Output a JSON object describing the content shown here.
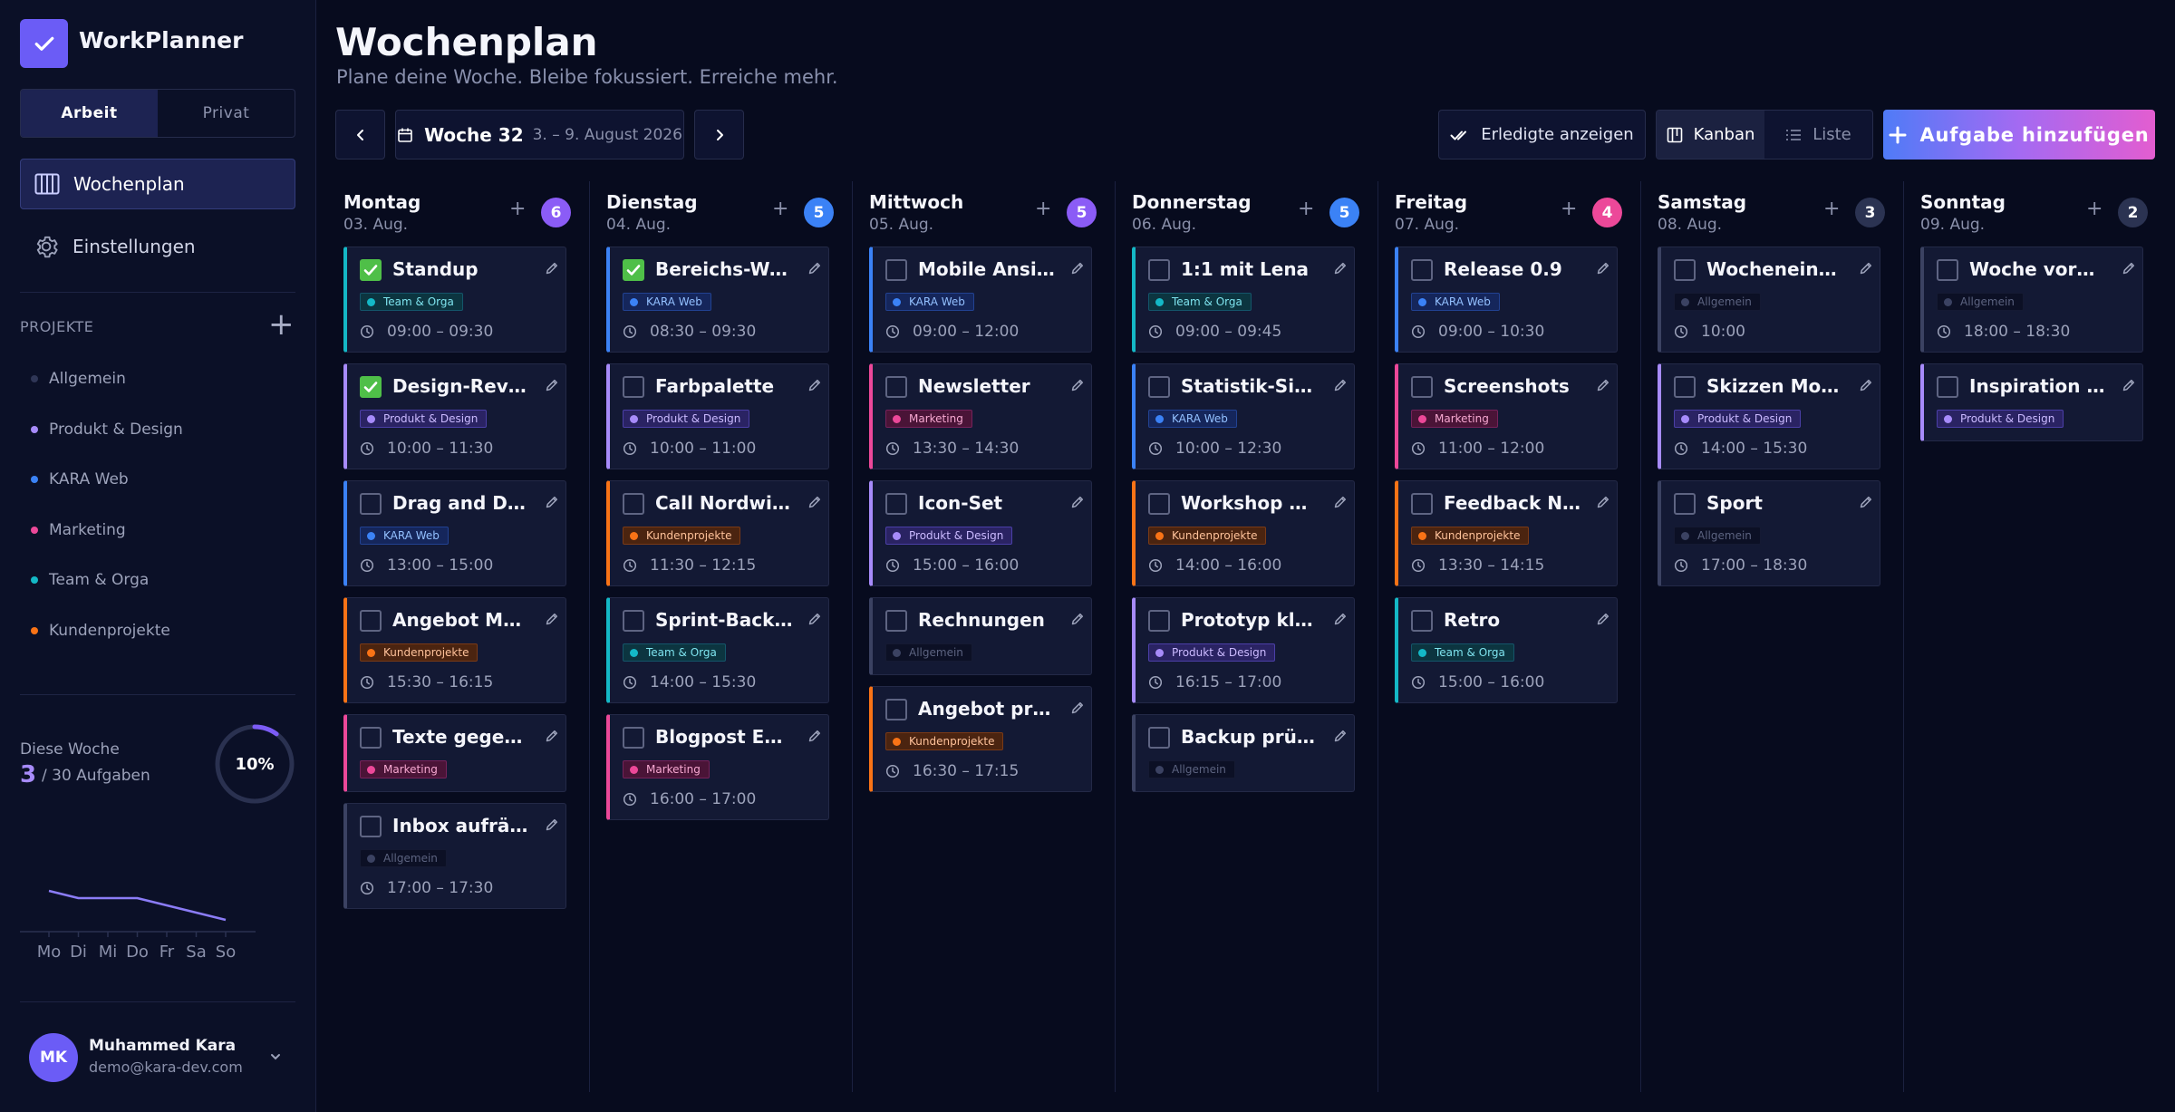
{
  "app": {
    "name": "WorkPlanner"
  },
  "mode_tabs": [
    "Arbeit",
    "Privat"
  ],
  "nav": [
    {
      "label": "Wochenplan",
      "icon": "board-icon"
    },
    {
      "label": "Einstellungen",
      "icon": "gear-icon"
    }
  ],
  "projects": {
    "heading": "PROJEKTE",
    "items": [
      {
        "label": "Allgemein",
        "color": "#2f3656"
      },
      {
        "label": "Produkt & Design",
        "color": "#a78bfa"
      },
      {
        "label": "KARA Web",
        "color": "#3b82f6"
      },
      {
        "label": "Marketing",
        "color": "#ec4899"
      },
      {
        "label": "Team & Orga",
        "color": "#14b8c6"
      },
      {
        "label": "Kundenprojekte",
        "color": "#f97316"
      }
    ]
  },
  "stats": {
    "label": "Diese Woche",
    "done": "3",
    "total": "/ 30 Aufgaben",
    "percent_label": "10%",
    "percent": 0.1,
    "days": [
      "Mo",
      "Di",
      "Mi",
      "Do",
      "Fr",
      "Sa",
      "So"
    ],
    "trend": [
      6,
      5,
      5,
      5,
      4,
      3,
      2
    ]
  },
  "user": {
    "initials": "MK",
    "name": "Muhammed Kara",
    "email": "demo@kara-dev.com"
  },
  "header": {
    "title": "Wochenplan",
    "subtitle": "Plane deine Woche. Bleibe fokussiert. Erreiche mehr.",
    "week_label": "Woche 32",
    "week_range": "3. – 9. August 2026",
    "show_done": "Erledigte anzeigen",
    "view_kanban": "Kanban",
    "view_list": "Liste",
    "add_task": "Aufgabe hinzufügen"
  },
  "tag_styles": {
    "Allgemein": {
      "color": "#3b4262",
      "bg": "#0c1025",
      "border": "#151a33",
      "text": "#5c6380"
    },
    "Produkt & Design": {
      "color": "#a78bfa",
      "bg": "#2a2363",
      "border": "#4b3fa7",
      "text": "#cbbaff"
    },
    "KARA Web": {
      "color": "#3b82f6",
      "bg": "#15265b",
      "border": "#224292",
      "text": "#93c0ff"
    },
    "Marketing": {
      "color": "#ec4899",
      "bg": "#4a1437",
      "border": "#76225a",
      "text": "#f7a8d1"
    },
    "Team & Orga": {
      "color": "#14b8c6",
      "bg": "#0c3540",
      "border": "#14556a",
      "text": "#7ee3ee"
    },
    "Kundenprojekte": {
      "color": "#f97316",
      "bg": "#4b2410",
      "border": "#7a3a16",
      "text": "#ffc29a"
    }
  },
  "days": [
    {
      "name": "Montag",
      "date": "03. Aug.",
      "count": "6",
      "badge_color": "#8b5cf6",
      "tasks": [
        {
          "title": "Standup",
          "tag": "Team & Orga",
          "time": "09:00 – 09:30",
          "done": true
        },
        {
          "title": "Design-Review",
          "tag": "Produkt & Design",
          "time": "10:00 – 11:30",
          "done": true
        },
        {
          "title": "Drag and Drop",
          "tag": "KARA Web",
          "time": "13:00 – 15:00",
          "done": false
        },
        {
          "title": "Angebot Meridian",
          "tag": "Kundenprojekte",
          "time": "15:30 – 16:15",
          "done": false
        },
        {
          "title": "Texte gegenlesen",
          "tag": "Marketing",
          "time": "",
          "done": false
        },
        {
          "title": "Inbox aufräumen",
          "tag": "Allgemein",
          "time": "17:00 – 17:30",
          "done": false
        }
      ]
    },
    {
      "name": "Dienstag",
      "date": "04. Aug.",
      "count": "5",
      "badge_color": "#3b82f6",
      "tasks": [
        {
          "title": "Bereichs-Wechsel",
          "tag": "KARA Web",
          "time": "08:30 – 09:30",
          "done": true
        },
        {
          "title": "Farbpalette",
          "tag": "Produkt & Design",
          "time": "10:00 – 11:00",
          "done": false
        },
        {
          "title": "Call Nordwind",
          "tag": "Kundenprojekte",
          "time": "11:30 – 12:15",
          "done": false
        },
        {
          "title": "Sprint-Backlog",
          "tag": "Team & Orga",
          "time": "14:00 – 15:30",
          "done": false
        },
        {
          "title": "Blogpost Entwurf",
          "tag": "Marketing",
          "time": "16:00 – 17:00",
          "done": false
        }
      ]
    },
    {
      "name": "Mittwoch",
      "date": "05. Aug.",
      "count": "5",
      "badge_color": "#8b5cf6",
      "tasks": [
        {
          "title": "Mobile Ansicht",
          "tag": "KARA Web",
          "time": "09:00 – 12:00",
          "done": false
        },
        {
          "title": "Newsletter",
          "tag": "Marketing",
          "time": "13:30 – 14:30",
          "done": false
        },
        {
          "title": "Icon-Set",
          "tag": "Produkt & Design",
          "time": "15:00 – 16:00",
          "done": false
        },
        {
          "title": "Rechnungen",
          "tag": "Allgemein",
          "time": "",
          "done": false
        },
        {
          "title": "Angebot prüfen",
          "tag": "Kundenprojekte",
          "time": "16:30 – 17:15",
          "done": false
        }
      ]
    },
    {
      "name": "Donnerstag",
      "date": "06. Aug.",
      "count": "5",
      "badge_color": "#3b82f6",
      "tasks": [
        {
          "title": "1:1 mit Lena",
          "tag": "Team & Orga",
          "time": "09:00 – 09:45",
          "done": false
        },
        {
          "title": "Statistik-Sidebar",
          "tag": "KARA Web",
          "time": "10:00 – 12:30",
          "done": false
        },
        {
          "title": "Workshop Meridian",
          "tag": "Kundenprojekte",
          "time": "14:00 – 16:00",
          "done": false
        },
        {
          "title": "Prototyp klicken",
          "tag": "Produkt & Design",
          "time": "16:15 – 17:00",
          "done": false
        },
        {
          "title": "Backup prüfen",
          "tag": "Allgemein",
          "time": "",
          "done": false
        }
      ]
    },
    {
      "name": "Freitag",
      "date": "07. Aug.",
      "count": "4",
      "badge_color": "#ec4899",
      "tasks": [
        {
          "title": "Release 0.9",
          "tag": "KARA Web",
          "time": "09:00 – 10:30",
          "done": false
        },
        {
          "title": "Screenshots",
          "tag": "Marketing",
          "time": "11:00 – 12:00",
          "done": false
        },
        {
          "title": "Feedback Nordwind",
          "tag": "Kundenprojekte",
          "time": "13:30 – 14:15",
          "done": false
        },
        {
          "title": "Retro",
          "tag": "Team & Orga",
          "time": "15:00 – 16:00",
          "done": false
        }
      ]
    },
    {
      "name": "Samstag",
      "date": "08. Aug.",
      "count": "3",
      "badge_color": "#2b3352",
      "tasks": [
        {
          "title": "Wocheneinkauf",
          "tag": "Allgemein",
          "time": "10:00",
          "done": false
        },
        {
          "title": "Skizzen Monatsplan",
          "tag": "Produkt & Design",
          "time": "14:00 – 15:30",
          "done": false
        },
        {
          "title": "Sport",
          "tag": "Allgemein",
          "time": "17:00 – 18:30",
          "done": false
        }
      ]
    },
    {
      "name": "Sonntag",
      "date": "09. Aug.",
      "count": "2",
      "badge_color": "#2b3352",
      "tasks": [
        {
          "title": "Woche vorbereiten",
          "tag": "Allgemein",
          "time": "18:00 – 18:30",
          "done": false
        },
        {
          "title": "Inspiration sammeln",
          "tag": "Produkt & Design",
          "time": "",
          "done": false
        }
      ]
    }
  ]
}
